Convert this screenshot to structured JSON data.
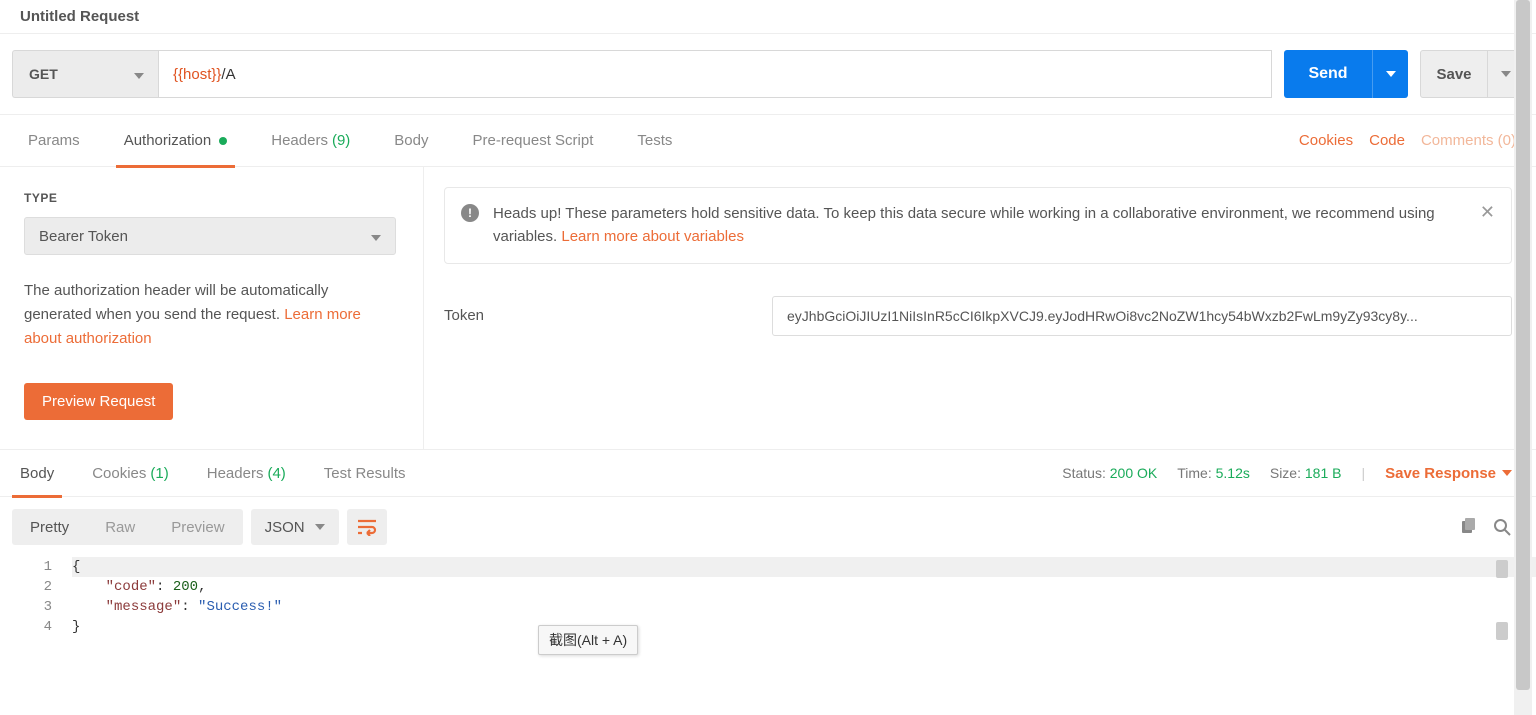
{
  "title": "Untitled Request",
  "request": {
    "method": "GET",
    "url_var": "{{host}}",
    "url_path": "/A",
    "send": "Send",
    "save": "Save"
  },
  "req_tabs": {
    "params": "Params",
    "authorization": "Authorization",
    "headers": "Headers",
    "headers_count": "(9)",
    "body": "Body",
    "prs": "Pre-request Script",
    "tests": "Tests"
  },
  "req_links": {
    "cookies": "Cookies",
    "code": "Code",
    "comments": "Comments (0)"
  },
  "auth": {
    "type_label": "TYPE",
    "type_value": "Bearer Token",
    "desc_a": "The authorization header will be automatically generated when you send the request. ",
    "desc_link": "Learn more about authorization",
    "preview": "Preview Request",
    "warning_a": "Heads up! These parameters hold sensitive data. To keep this data secure while working in a collaborative environment, we recommend using variables. ",
    "warning_link": "Learn more about variables",
    "token_label": "Token",
    "token_value": "eyJhbGciOiJIUzI1NiIsInR5cCI6IkpXVCJ9.eyJodHRwOi8vc2NoZW1hcy54bWxzb2FwLm9yZy93cy8y..."
  },
  "resp_tabs": {
    "body": "Body",
    "cookies": "Cookies",
    "cookies_count": "(1)",
    "headers": "Headers",
    "headers_count": "(4)",
    "tests": "Test Results"
  },
  "resp_meta": {
    "status_label": "Status:",
    "status_value": "200 OK",
    "time_label": "Time:",
    "time_value": "5.12s",
    "size_label": "Size:",
    "size_value": "181 B",
    "save_response": "Save Response"
  },
  "view": {
    "pretty": "Pretty",
    "raw": "Raw",
    "preview": "Preview",
    "format": "JSON"
  },
  "code": {
    "l1": "{",
    "l2_key": "\"code\"",
    "l2_val": "200",
    "l3_key": "\"message\"",
    "l3_val": "\"Success!\"",
    "l4": "}",
    "n1": "1",
    "n2": "2",
    "n3": "3",
    "n4": "4"
  },
  "tooltip": "截图(Alt + A)"
}
